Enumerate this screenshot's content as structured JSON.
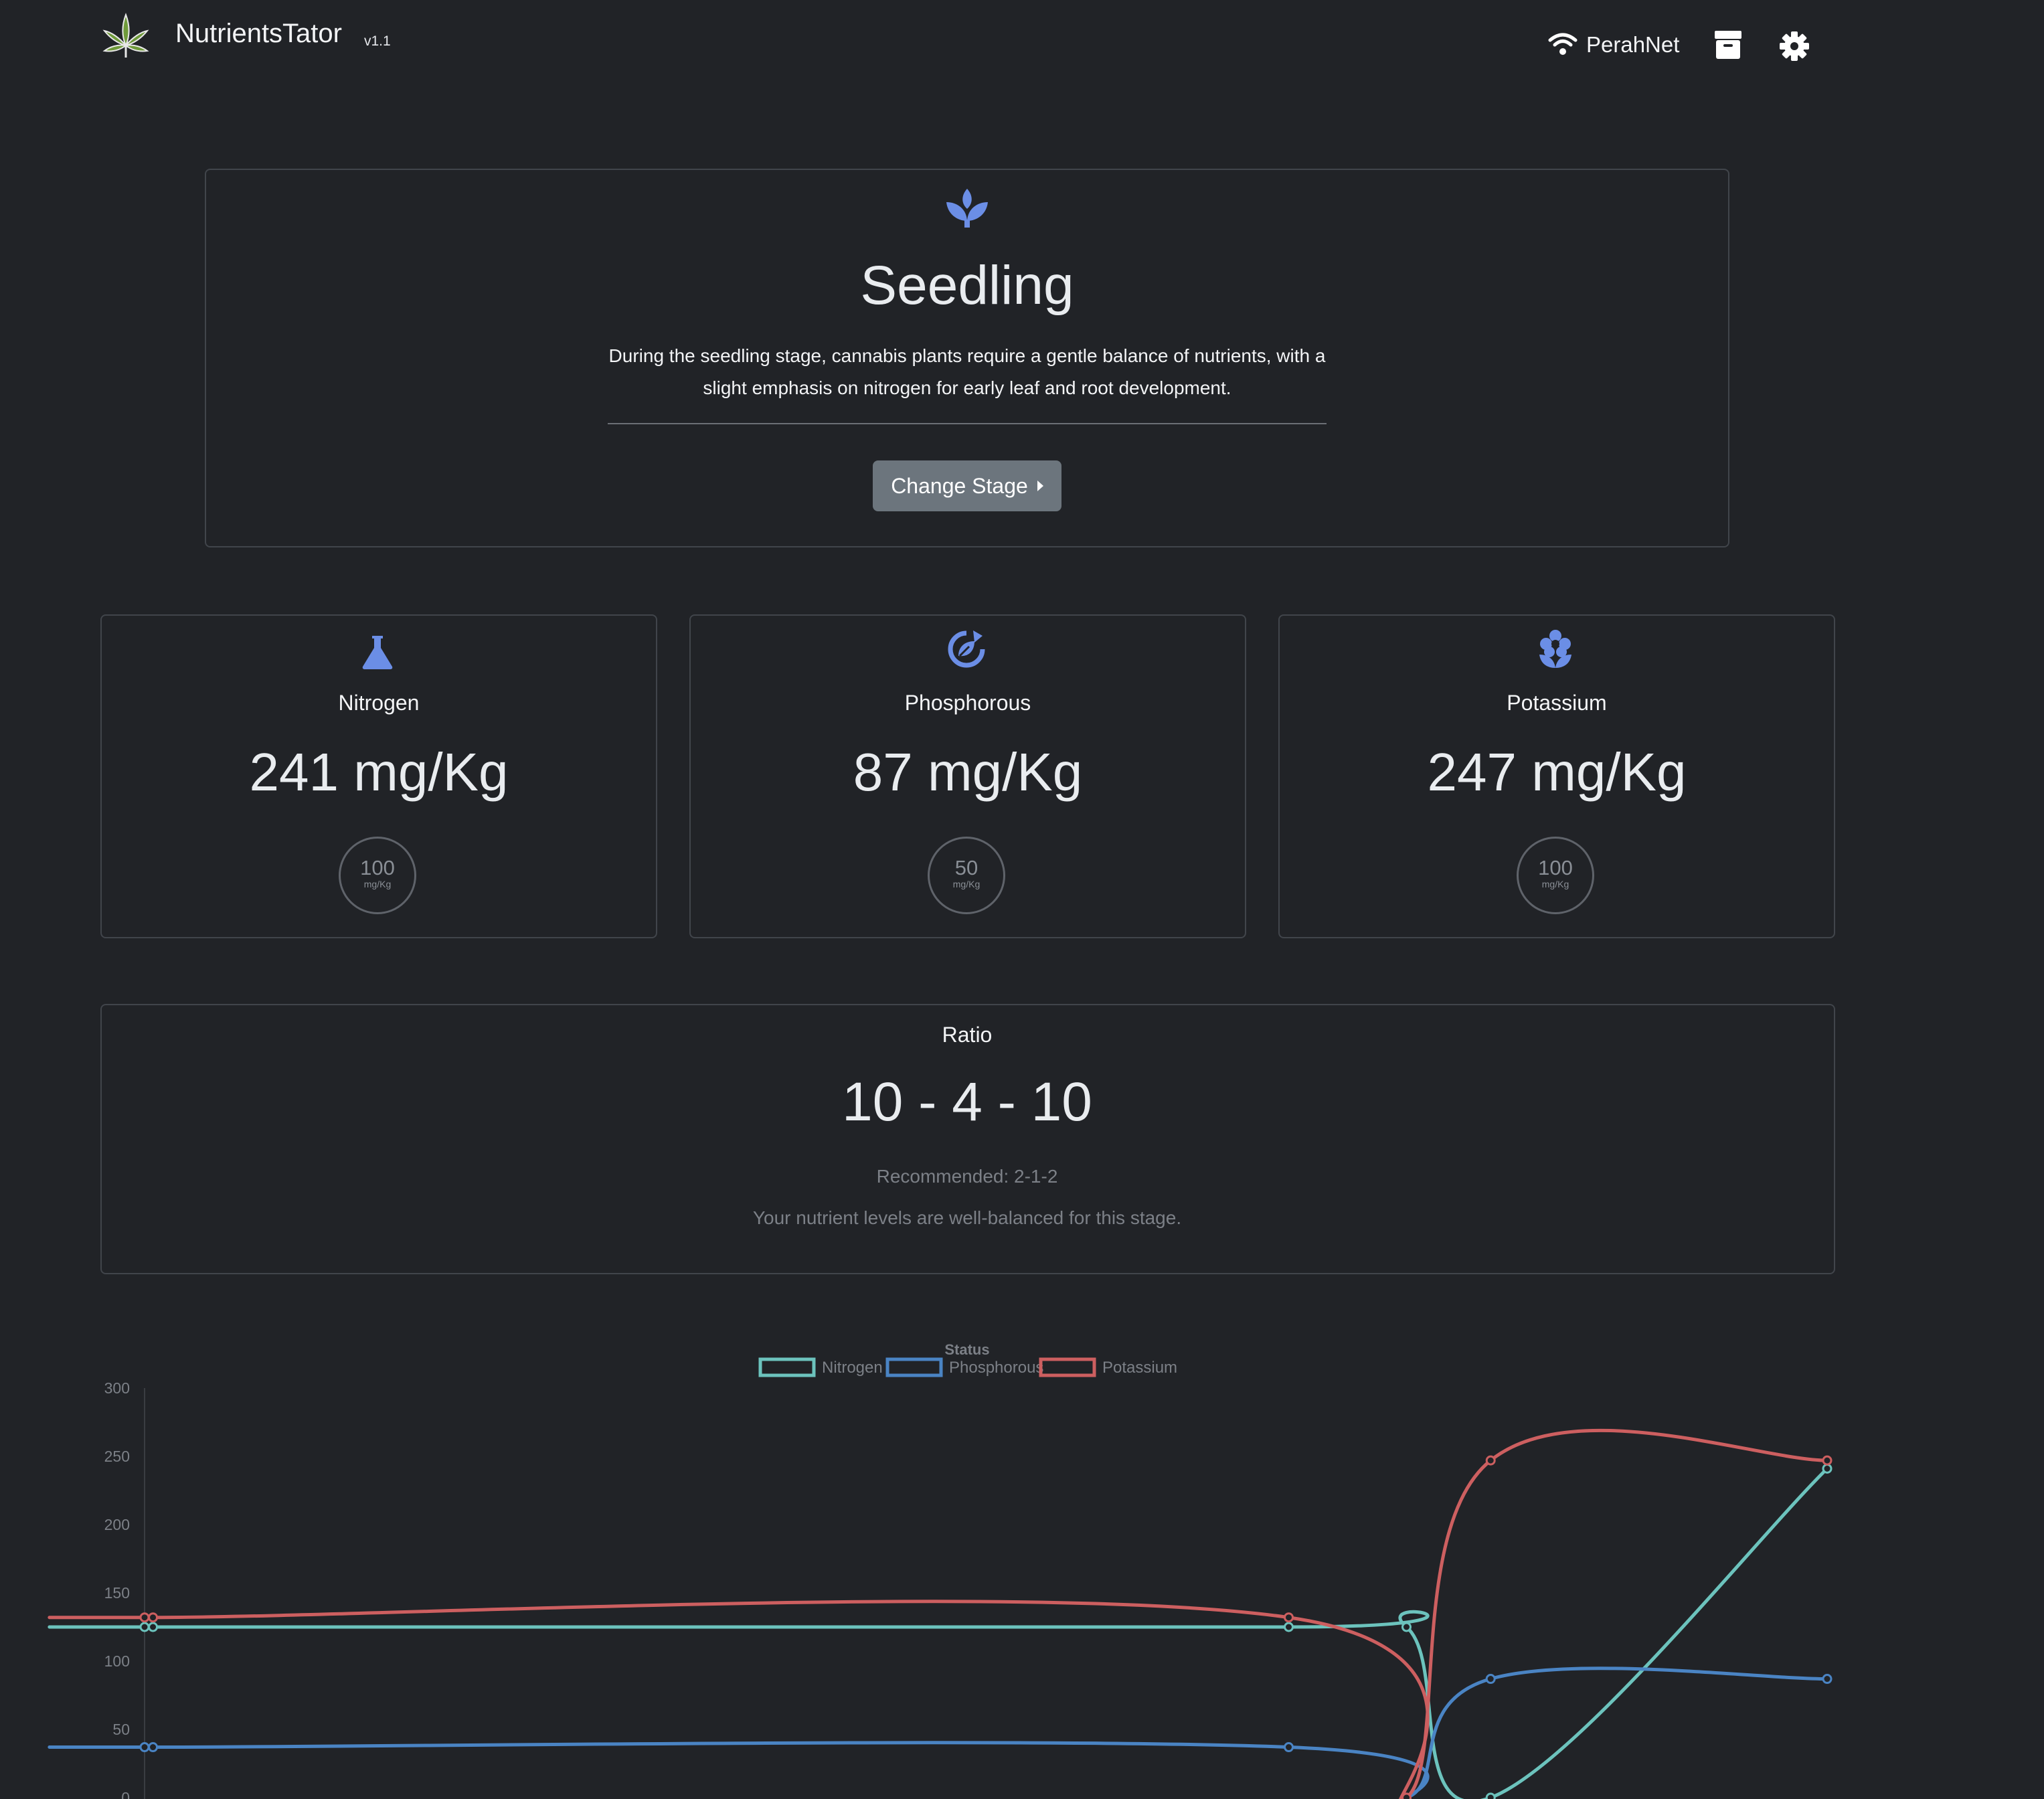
{
  "navbar": {
    "brand": "NutrientsTator",
    "version": "v1.1",
    "network": "PerahNet",
    "icons": [
      "cannabis-leaf-logo",
      "wifi-icon",
      "archive-icon",
      "gear-icon"
    ]
  },
  "stage": {
    "icon": "seedling-icon",
    "title": "Seedling",
    "description": "During the seedling stage, cannabis plants require a gentle balance of nutrients, with a slight emphasis on nitrogen for early leaf and root development.",
    "change_button": "Change Stage"
  },
  "nutrients": [
    {
      "name": "Nitrogen",
      "icon": "flask-icon",
      "value": "241 mg/Kg",
      "target": "100",
      "target_unit": "mg/Kg"
    },
    {
      "name": "Phosphorous",
      "icon": "recycle-leaf-icon",
      "value": "87 mg/Kg",
      "target": "50",
      "target_unit": "mg/Kg"
    },
    {
      "name": "Potassium",
      "icon": "flower-icon",
      "value": "247 mg/Kg",
      "target": "100",
      "target_unit": "mg/Kg"
    }
  ],
  "ratio": {
    "label": "Ratio",
    "value": "10 - 4 - 10",
    "recommended": "Recommended: 2-1-2",
    "message": "Your nutrient levels are well-balanced for this stage."
  },
  "colors": {
    "accent": "#6b8ee6",
    "nitrogen": "#6cc3bd",
    "phosphorous": "#4a84c4",
    "potassium": "#cd5f60",
    "background": "#212327"
  },
  "chart_data": {
    "type": "line",
    "title": "Status",
    "legend_position": "top",
    "ylim": [
      0,
      300
    ],
    "yticks": [
      0,
      50,
      100,
      150,
      200,
      250,
      300
    ],
    "x": [
      0,
      0.5,
      68,
      75,
      80,
      100
    ],
    "series": [
      {
        "name": "Nitrogen",
        "color": "#6cc3bd",
        "values": [
          125,
          125,
          125,
          125,
          0,
          241
        ]
      },
      {
        "name": "Phosphorous",
        "color": "#4a84c4",
        "values": [
          37,
          37,
          37,
          0,
          87,
          87
        ]
      },
      {
        "name": "Potassium",
        "color": "#cd5f60",
        "values": [
          132,
          132,
          132,
          0,
          247,
          247
        ]
      }
    ]
  }
}
